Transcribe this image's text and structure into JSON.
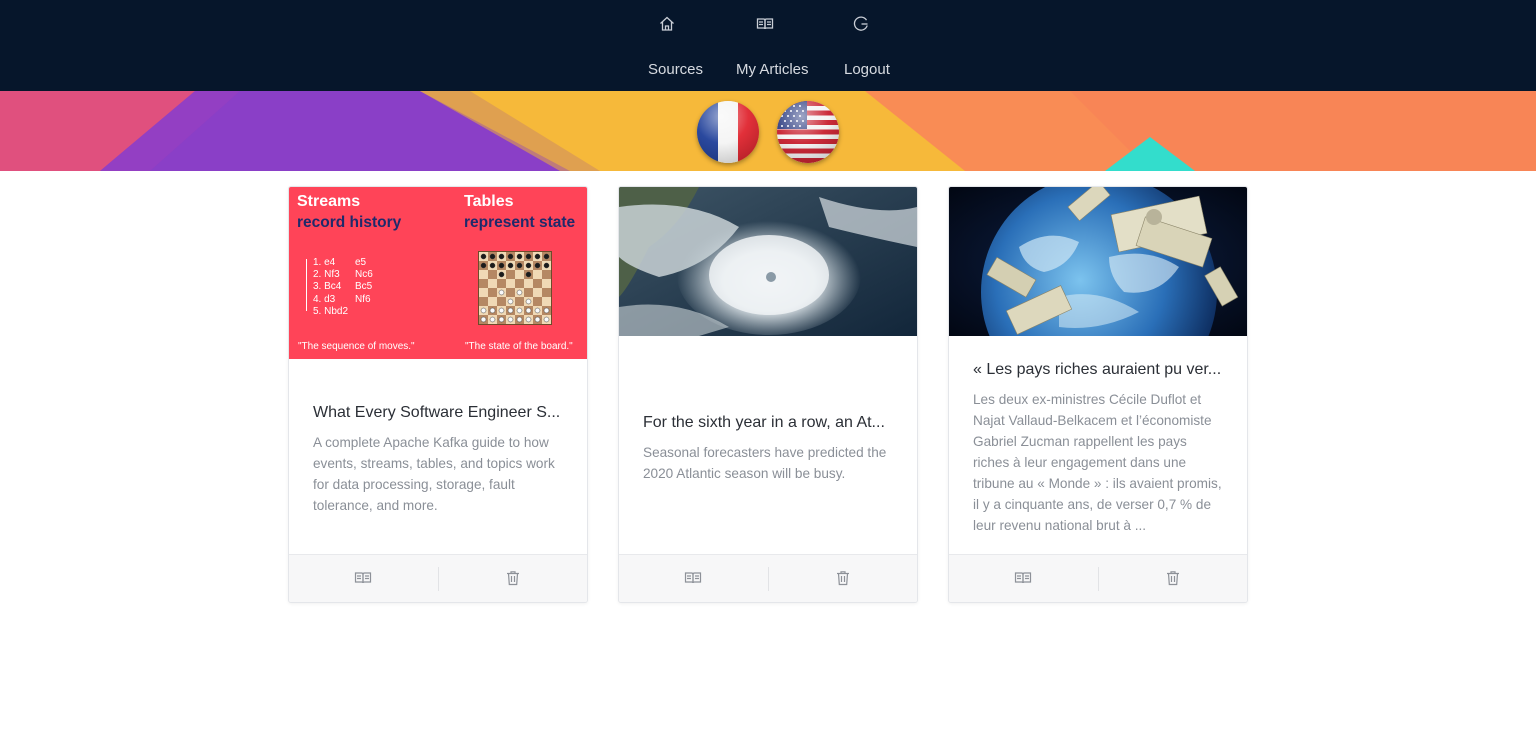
{
  "nav": {
    "icons": [
      "home-icon",
      "book-open-icon",
      "logout-icon"
    ],
    "links": [
      "Sources",
      "My Articles",
      "Logout"
    ]
  },
  "flags": {
    "left": "France",
    "right": "United States"
  },
  "colors": {
    "nav_bg": "#06162b",
    "banner_yellow": "#f6b93a",
    "banner_purple": "#8a3fc7",
    "banner_pink": "#e0507e",
    "banner_orange": "#f98c55",
    "banner_teal": "#33ddcc",
    "kafka_red": "#ff4458"
  },
  "cards": [
    {
      "title": "What Every Software Engineer S...",
      "description": "A complete Apache Kafka guide to how events, streams, tables, and topics work for data processing, storage, fault tolerance, and more.",
      "image": {
        "streams_title": "Streams",
        "streams_subtitle": "record history",
        "tables_title": "Tables",
        "tables_subtitle": "represent state",
        "moves": [
          [
            "1. e4",
            "e5"
          ],
          [
            "2. Nf3",
            "Nc6"
          ],
          [
            "3. Bc4",
            "Bc5"
          ],
          [
            "4. d3",
            "Nf6"
          ],
          [
            "5. Nbd2",
            ""
          ]
        ],
        "caption_left": "\"The sequence of moves.\"",
        "caption_right": "\"The state of the board.\""
      }
    },
    {
      "title": "For the sixth year in a row, an At...",
      "description": "Seasonal forecasters have predicted the 2020 Atlantic season will be busy.",
      "image": "hurricane satellite"
    },
    {
      "title": "« Les pays riches auraient pu ver...",
      "description": "Les deux ex-ministres Cécile Duflot et Najat Vallaud-Belkacem et l’économiste Gabriel Zucman rappellent les pays riches à leur engagement dans une tribune au « Monde » : ils avaient promis, il y a cinquante ans, de verser 0,7 % de leur revenu national brut à ...",
      "image": "globe with dollar bills"
    }
  ],
  "card_actions": [
    "read-icon",
    "trash-icon"
  ]
}
